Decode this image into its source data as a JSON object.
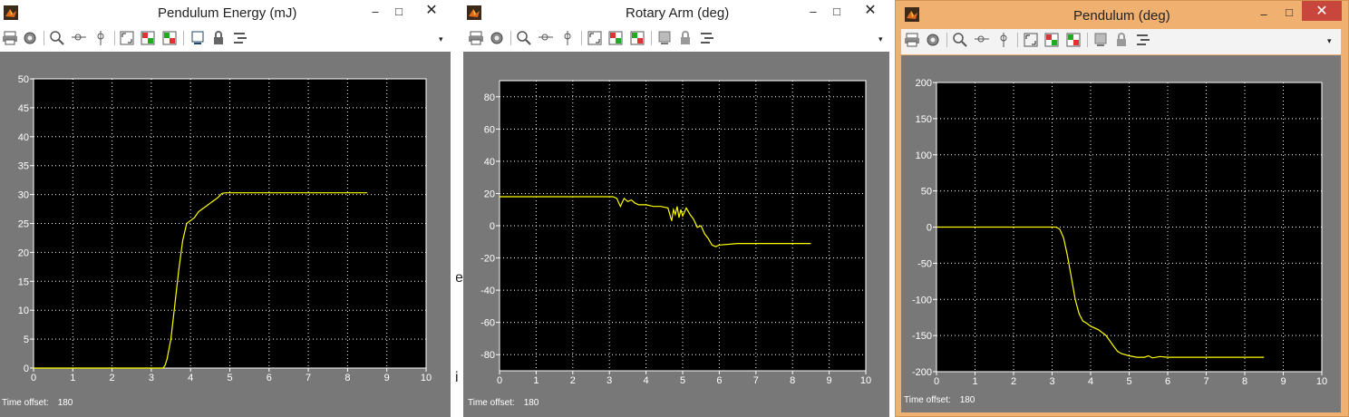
{
  "colors": {
    "plot_bg": "#000000",
    "frame_bg": "#787878",
    "trace": "#ffff00",
    "grid": "#ffffff",
    "tick_text": "#ffffff",
    "active_frame": "#f0b070"
  },
  "toolbar_icons": [
    "print-icon",
    "params-icon",
    "zoom-in-icon",
    "zoom-x-icon",
    "zoom-y-icon",
    "autoscale-icon",
    "save-axes-icon",
    "restore-axes-icon",
    "floating-scope-icon",
    "lock-axes-icon",
    "signal-selector-icon"
  ],
  "background_fragments": [
    "e",
    "i"
  ],
  "windows": [
    {
      "title": "Pendulum Energy (mJ)",
      "minimize": "‒",
      "maximize": "□",
      "close": "✕",
      "time_offset_label": "Time offset:",
      "time_offset_value": "180",
      "chart_data": {
        "type": "line",
        "title": "Pendulum Energy (mJ)",
        "xlabel": "",
        "ylabel": "",
        "xlim": [
          0,
          10
        ],
        "ylim": [
          0,
          50
        ],
        "xticks": [
          "0",
          "1",
          "2",
          "3",
          "4",
          "5",
          "6",
          "7",
          "8",
          "9",
          "10"
        ],
        "yticks": [
          "0",
          "5",
          "10",
          "15",
          "20",
          "25",
          "30",
          "35",
          "40",
          "45",
          "50"
        ],
        "grid": true,
        "series": [
          {
            "color": "#ffff00",
            "x": [
              0,
              3.3,
              3.35,
              3.4,
              3.5,
              3.6,
              3.7,
              3.8,
              3.9,
              4.0,
              4.1,
              4.2,
              4.3,
              4.4,
              4.5,
              4.6,
              4.7,
              4.8,
              4.9,
              5.0,
              6.0,
              7.0,
              8.0,
              8.5
            ],
            "y": [
              0,
              0,
              0.5,
              1.5,
              5,
              11,
              17,
              22,
              25,
              25.5,
              26,
              27,
              27.5,
              28,
              28.5,
              29,
              29.5,
              30.2,
              30.3,
              30.3,
              30.3,
              30.3,
              30.3,
              30.3
            ]
          }
        ]
      }
    },
    {
      "title": "Rotary Arm (deg)",
      "minimize": "‒",
      "maximize": "□",
      "close": "✕",
      "time_offset_label": "Time offset:",
      "time_offset_value": "180",
      "chart_data": {
        "type": "line",
        "title": "Rotary Arm (deg)",
        "xlabel": "",
        "ylabel": "",
        "xlim": [
          0,
          10
        ],
        "ylim": [
          -90,
          90
        ],
        "xticks": [
          "0",
          "1",
          "2",
          "3",
          "4",
          "5",
          "6",
          "7",
          "8",
          "9",
          "10"
        ],
        "yticks": [
          "-80",
          "-60",
          "-40",
          "-20",
          "0",
          "20",
          "40",
          "60",
          "80"
        ],
        "ytick_values": [
          -80,
          -60,
          -40,
          -20,
          0,
          20,
          40,
          60,
          80
        ],
        "grid": true,
        "series": [
          {
            "color": "#ffff00",
            "x": [
              0,
              3.0,
              3.1,
              3.2,
              3.3,
              3.4,
              3.5,
              3.6,
              3.7,
              3.8,
              4.0,
              4.2,
              4.4,
              4.6,
              4.7,
              4.75,
              4.8,
              4.85,
              4.9,
              4.95,
              5.0,
              5.1,
              5.2,
              5.3,
              5.4,
              5.5,
              5.6,
              5.7,
              5.8,
              5.9,
              6.0,
              6.5,
              7.0,
              8.0,
              8.5
            ],
            "y": [
              18,
              18,
              18,
              17,
              12,
              17,
              15,
              16,
              14,
              13,
              13,
              12,
              12,
              11,
              3,
              10,
              7,
              12,
              5,
              10,
              6,
              11,
              7,
              4,
              -1,
              0,
              -5,
              -8,
              -12,
              -13,
              -12,
              -11,
              -11,
              -11,
              -11
            ]
          }
        ]
      }
    },
    {
      "title": "Pendulum (deg)",
      "minimize": "‒",
      "maximize": "□",
      "close": "✕",
      "time_offset_label": "Time offset:",
      "time_offset_value": "180",
      "chart_data": {
        "type": "line",
        "title": "Pendulum (deg)",
        "xlabel": "",
        "ylabel": "",
        "xlim": [
          0,
          10
        ],
        "ylim": [
          -200,
          200
        ],
        "xticks": [
          "0",
          "1",
          "2",
          "3",
          "4",
          "5",
          "6",
          "7",
          "8",
          "9",
          "10"
        ],
        "yticks": [
          "-200",
          "-150",
          "-100",
          "-50",
          "0",
          "50",
          "100",
          "150",
          "200"
        ],
        "ytick_values": [
          -200,
          -150,
          -100,
          -50,
          0,
          50,
          100,
          150,
          200
        ],
        "grid": true,
        "series": [
          {
            "color": "#ffff00",
            "x": [
              0,
              3.0,
              3.1,
              3.2,
              3.3,
              3.4,
              3.5,
              3.6,
              3.7,
              3.8,
              3.9,
              4.0,
              4.2,
              4.4,
              4.6,
              4.7,
              4.8,
              5.0,
              5.2,
              5.4,
              5.5,
              5.6,
              5.8,
              6.0,
              7.0,
              8.0,
              8.5
            ],
            "y": [
              0,
              0,
              0,
              -3,
              -15,
              -40,
              -70,
              -100,
              -120,
              -130,
              -133,
              -137,
              -142,
              -150,
              -165,
              -172,
              -175,
              -178,
              -180,
              -180,
              -178,
              -181,
              -179,
              -180,
              -180,
              -180,
              -180
            ]
          }
        ]
      }
    }
  ]
}
